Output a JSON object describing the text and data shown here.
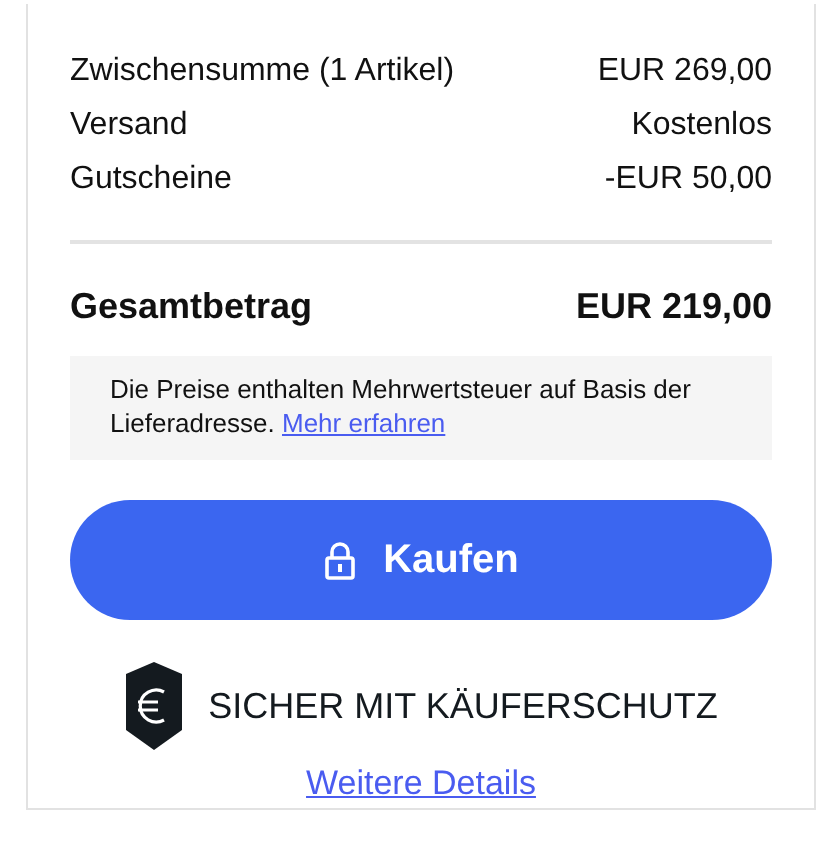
{
  "summary_rows": [
    {
      "label": "Zwischensumme (1 Artikel)",
      "value": "EUR 269,00"
    },
    {
      "label": "Versand",
      "value": "Kostenlos"
    },
    {
      "label": "Gutscheine",
      "value": "-EUR 50,00"
    }
  ],
  "total": {
    "label": "Gesamtbetrag",
    "value": "EUR 219,00"
  },
  "vat_note": {
    "text": "Die Preise enthalten Mehrwertsteuer auf Basis der Lieferadresse.",
    "link": "Mehr erfahren"
  },
  "buy_button": {
    "label": "Kaufen"
  },
  "protection": {
    "label": "SICHER MIT KÄUFERSCHUTZ",
    "link": "Weitere Details"
  }
}
